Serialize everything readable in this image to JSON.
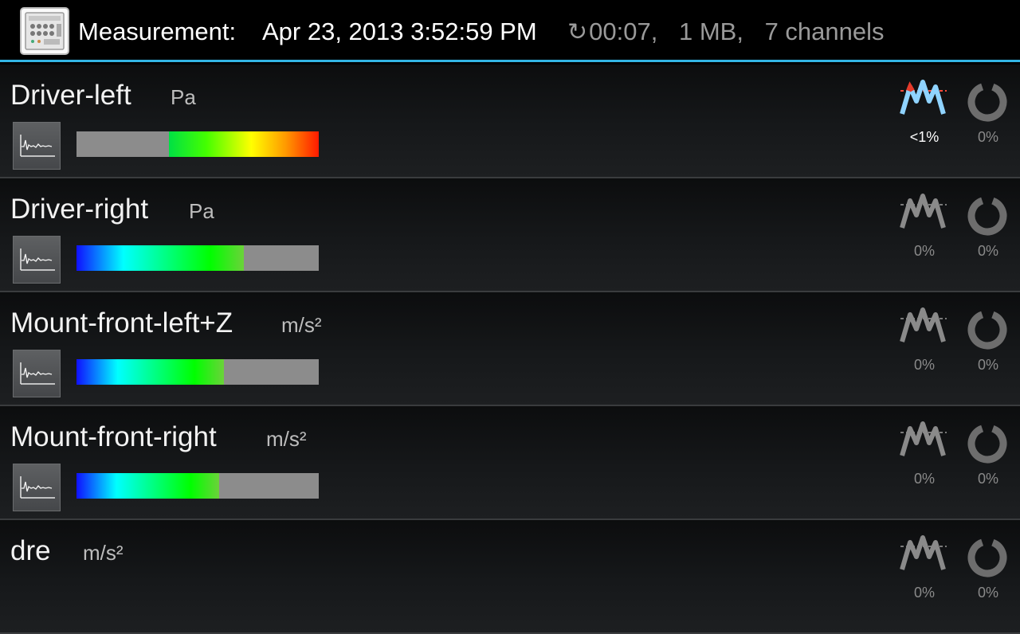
{
  "header": {
    "app_icon": "data-recorder-device-icon",
    "label": "Measurement:",
    "datetime": "Apr 23, 2013 3:52:59 PM",
    "refresh_icon": "refresh-icon",
    "elapsed": "00:07,",
    "size": "1 MB,",
    "channels": "7 channels",
    "accent_color": "#33b5e5"
  },
  "channels": [
    {
      "name": "Driver-left",
      "unit": "Pa",
      "plot_icon": "time-signal-plot-icon",
      "level_percent": 62,
      "level_scheme": "warm-from-right",
      "overload_active": true,
      "overload_pct": "<1%",
      "ring_pct": "0%"
    },
    {
      "name": "Driver-right",
      "unit": "Pa",
      "plot_icon": "time-signal-plot-icon",
      "level_percent": 69,
      "level_scheme": "cool-from-left",
      "overload_active": false,
      "overload_pct": "0%",
      "ring_pct": "0%"
    },
    {
      "name": "Mount-front-left+Z",
      "unit": "m/s²",
      "plot_icon": "time-signal-plot-icon",
      "level_percent": 61,
      "level_scheme": "cool-from-left",
      "overload_active": false,
      "overload_pct": "0%",
      "ring_pct": "0%"
    },
    {
      "name": "Mount-front-right",
      "unit": "m/s²",
      "plot_icon": "time-signal-plot-icon",
      "level_percent": 59,
      "level_scheme": "cool-from-left",
      "overload_active": false,
      "overload_pct": "0%",
      "ring_pct": "0%"
    },
    {
      "name": "dre",
      "unit": "m/s²",
      "plot_icon": "time-signal-plot-icon",
      "level_percent": null,
      "level_scheme": "cool-from-left",
      "overload_active": false,
      "overload_pct": "0%",
      "ring_pct": "0%"
    }
  ]
}
